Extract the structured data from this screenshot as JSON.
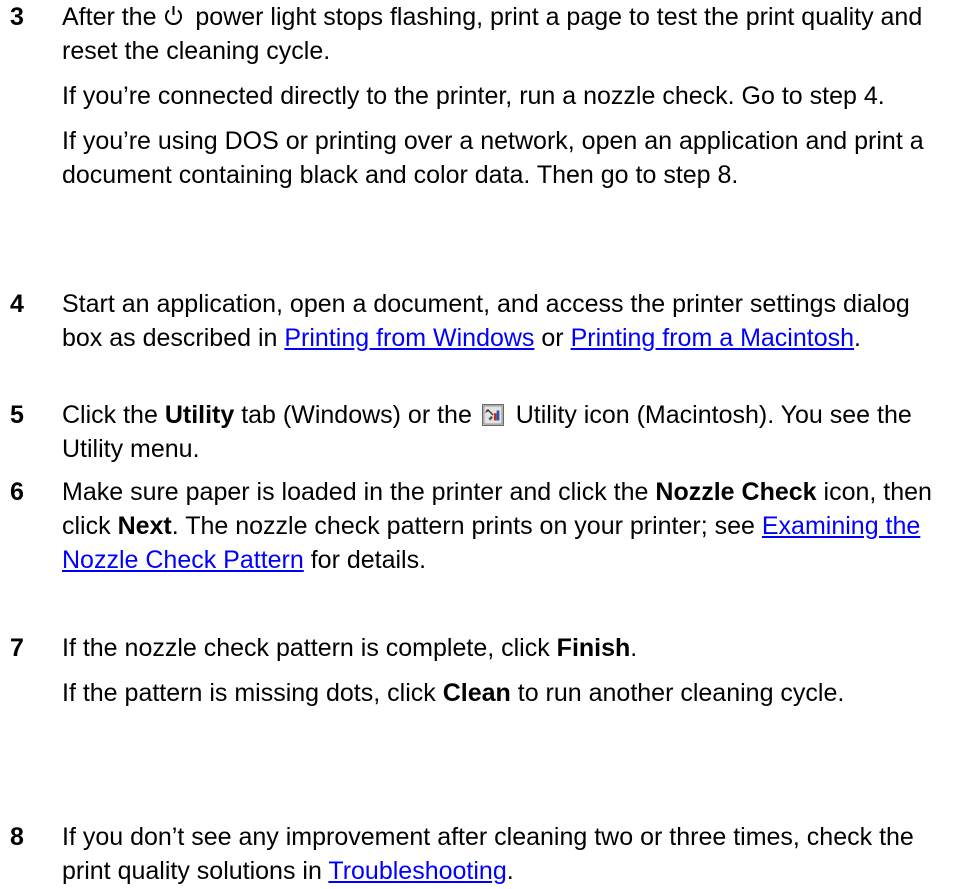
{
  "steps": [
    {
      "number": "3",
      "paras": [
        {
          "before_icon": "After the ",
          "icon": "power-icon",
          "after_icon": " power light stops flashing, print a page to test the print quality and reset the cleaning cycle."
        },
        {
          "text": "If you’re connected directly to the printer, run a nozzle check. Go to step 4."
        },
        {
          "text": "If you’re using DOS or printing over a network, open an application and print a document containing black and color data. Then go to step 8."
        }
      ]
    },
    {
      "number": "4",
      "text_a": "Start an application, open a document, and access the printer settings dialog box as described in ",
      "link_a": "Printing from Windows",
      "text_b": " or ",
      "link_b": "Printing from a Macintosh",
      "text_c": "."
    },
    {
      "number": "5",
      "text_a": "Click the ",
      "bold_a": "Utility",
      "text_b": " tab (Windows) or the ",
      "icon": "utility-icon",
      "text_c": " Utility icon (Macintosh). You see the Utility menu."
    },
    {
      "number": "6",
      "text_a": "Make sure paper is loaded in the printer and click the ",
      "bold_a": "Nozzle Check",
      "text_b": " icon, then click ",
      "bold_b": "Next",
      "text_c": ". The nozzle check pattern prints on your printer; see ",
      "link_a": "Examining the Nozzle Check Pattern",
      "text_d": " for details."
    },
    {
      "number": "7",
      "para1_text_a": "If the nozzle check pattern is complete, click ",
      "para1_bold": "Finish",
      "para1_text_b": ".",
      "para2_text_a": "If the pattern is missing dots, click ",
      "para2_bold": "Clean",
      "para2_text_b": " to run another cleaning cycle."
    },
    {
      "number": "8",
      "text_a": "If you don’t see any improvement after cleaning two or three times, check the print quality solutions in ",
      "link_a": "Troubleshooting",
      "text_b": "."
    }
  ]
}
